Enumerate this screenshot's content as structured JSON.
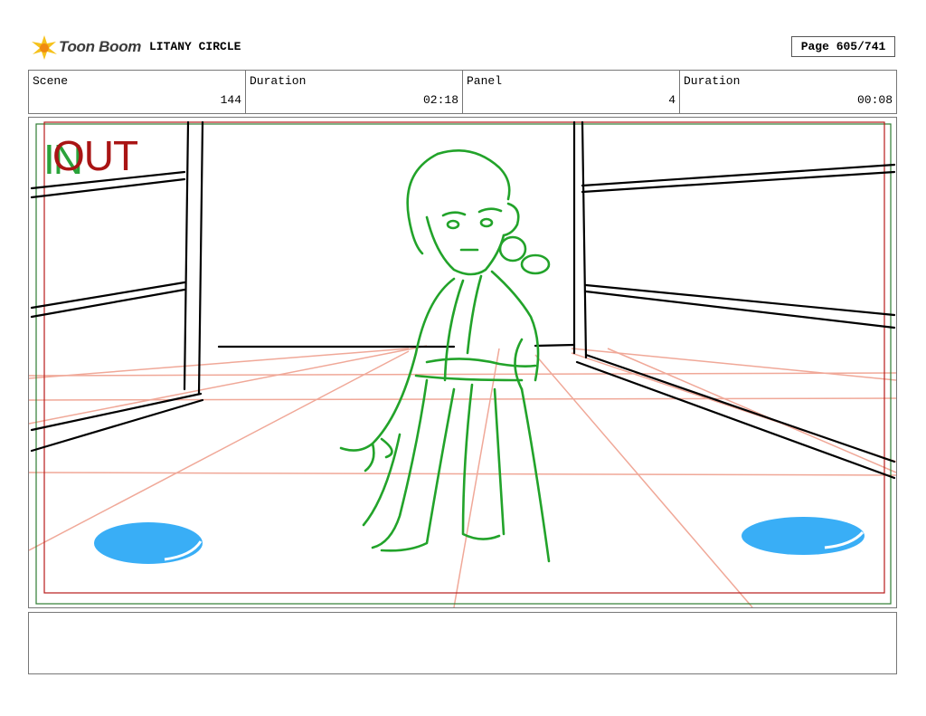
{
  "header": {
    "logo_text": "Toon Boom",
    "project_title": "LITANY CIRCLE",
    "page_label": "Page 605/741"
  },
  "info": [
    {
      "label": "Scene",
      "value": "144"
    },
    {
      "label": "Duration",
      "value": "02:18"
    },
    {
      "label": "Panel",
      "value": "4"
    },
    {
      "label": "Duration",
      "value": "00:08"
    }
  ],
  "panel": {
    "in_label": "IN",
    "out_label": "OUT",
    "colors": {
      "sketch": "#22a32a",
      "lines": "#000000",
      "perspective": "#f0a898",
      "puddle": "#39aef6",
      "frame_in": "#2e7d32",
      "frame_out": "#b71c1c"
    }
  },
  "notes": {
    "text": ""
  }
}
